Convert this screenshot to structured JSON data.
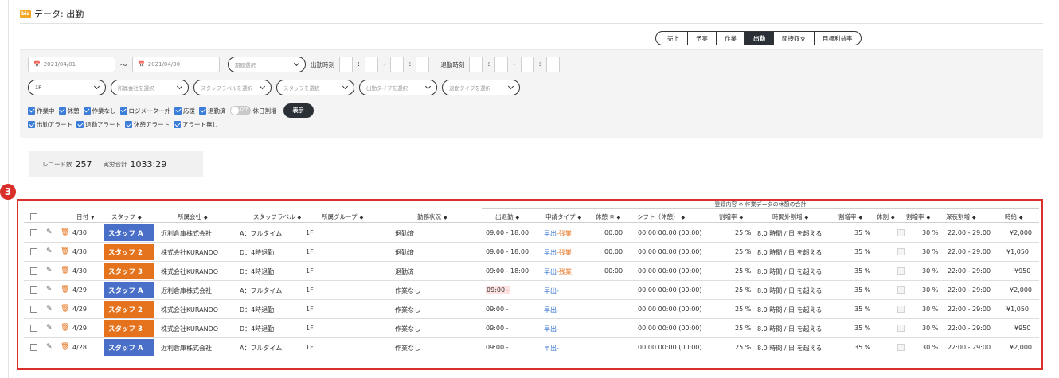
{
  "header": {
    "logo_text": "bis",
    "title": "データ: 出勤"
  },
  "tabs": [
    {
      "label": "売上",
      "active": false
    },
    {
      "label": "予実",
      "active": false
    },
    {
      "label": "作業",
      "active": false
    },
    {
      "label": "出勤",
      "active": true
    },
    {
      "label": "間接収支",
      "active": false
    },
    {
      "label": "目標利益率",
      "active": false
    }
  ],
  "filters": {
    "date_from": "2021/04/01",
    "range_sep": "〜",
    "date_to": "2021/04/30",
    "period_placeholder": "期間選択",
    "clock_in_label": "出勤時刻",
    "clock_out_label": "退勤時刻",
    "colon": ":",
    "dash": "-",
    "floor_value": "1F",
    "company_placeholder": "所属会社を選択",
    "staff_label_placeholder": "スタッフラベルを選択",
    "staff_placeholder": "スタッフを選択",
    "attendance_type_placeholder": "出勤タイプを選択",
    "leave_type_placeholder": "退勤タイプを選択",
    "checks_row1": [
      "作業中",
      "休憩",
      "作業なし",
      "ロジメーター外",
      "応援",
      "退勤済"
    ],
    "toggle_text": "OFF",
    "holiday_label": "休日割増",
    "show_button": "表示",
    "checks_row2": [
      "出勤アラート",
      "退勤アラート",
      "休憩アラート",
      "アラート無し"
    ]
  },
  "summary": {
    "records_label": "レコード数",
    "records_value": "257",
    "actual_label": "実労合計",
    "actual_value": "1033:29"
  },
  "step_badge": "3",
  "table": {
    "group_header": "登録内容 ※ 作業データの休憩の合計",
    "columns": {
      "date": "日付",
      "staff": "スタッフ",
      "company": "所属会社",
      "label": "スタッフラベル",
      "group": "所属グループ",
      "status": "勤務状況",
      "inout": "出退勤",
      "apply": "申請タイプ",
      "break": "休憩 ※",
      "shift": "シフト（休憩）",
      "rate1": "割増率",
      "overtime": "時間外割増",
      "rate2": "割増率",
      "holiday": "休割",
      "rate3": "割増率",
      "night": "深夜割増",
      "wage": "時給"
    },
    "rows": [
      {
        "date": "4/30",
        "staff": "スタッフ A",
        "staff_color": "#4a6fc8",
        "company": "近利倉庫株式会社",
        "label": "A：フルタイム",
        "group": "1F",
        "status": "退勤済",
        "inout": "09:00 - 18:00",
        "apply_a": "早出",
        "apply_b": "-残業",
        "brk": "00:00",
        "shift": "00:00 00:00 (00:00)",
        "rate1": "25 %",
        "overtime": "8.0 時間 / 日 を超える",
        "rate2": "35 %",
        "rate3": "30 %",
        "night": "22:00 - 29:00",
        "wage": "¥2,000"
      },
      {
        "date": "4/30",
        "staff": "スタッフ 2",
        "staff_color": "#e5731e",
        "company": "株式会社KURANDO",
        "label": "D：4時退勤",
        "group": "1F",
        "status": "退勤済",
        "inout": "09:00 - 18:00",
        "apply_a": "早出",
        "apply_b": "-残業",
        "brk": "00:00",
        "shift": "00:00 00:00 (00:00)",
        "rate1": "25 %",
        "overtime": "8.0 時間 / 日 を超える",
        "rate2": "35 %",
        "rate3": "30 %",
        "night": "22:00 - 29:00",
        "wage": "¥1,050"
      },
      {
        "date": "4/30",
        "staff": "スタッフ 3",
        "staff_color": "#e5731e",
        "company": "株式会社KURANDO",
        "label": "D：4時退勤",
        "group": "1F",
        "status": "退勤済",
        "inout": "09:00 - 18:00",
        "apply_a": "早出",
        "apply_b": "-残業",
        "brk": "00:00",
        "shift": "00:00 00:00 (00:00)",
        "rate1": "25 %",
        "overtime": "8.0 時間 / 日 を超える",
        "rate2": "35 %",
        "rate3": "30 %",
        "night": "22:00 - 29:00",
        "wage": "¥950"
      },
      {
        "date": "4/29",
        "staff": "スタッフ A",
        "staff_color": "#4a6fc8",
        "company": "近利倉庫株式会社",
        "label": "A：フルタイム",
        "group": "1F",
        "status": "作業なし",
        "inout": "09:00 -",
        "apply_a": "早出",
        "apply_b": "-",
        "brk": "",
        "shift": "00:00 00:00 (00:00)",
        "rate1": "25 %",
        "overtime": "8.0 時間 / 日 を超える",
        "rate2": "35 %",
        "rate3": "30 %",
        "night": "22:00 - 29:00",
        "wage": "¥2,000"
      },
      {
        "date": "4/29",
        "staff": "スタッフ 2",
        "staff_color": "#e5731e",
        "company": "株式会社KURANDO",
        "label": "D：4時退勤",
        "group": "1F",
        "status": "作業なし",
        "inout": "09:00 -",
        "apply_a": "早出",
        "apply_b": "-",
        "brk": "",
        "shift": "00:00 00:00 (00:00)",
        "rate1": "25 %",
        "overtime": "8.0 時間 / 日 を超える",
        "rate2": "35 %",
        "rate3": "30 %",
        "night": "22:00 - 29:00",
        "wage": "¥1,050"
      },
      {
        "date": "4/29",
        "staff": "スタッフ 3",
        "staff_color": "#e5731e",
        "company": "株式会社KURANDO",
        "label": "D：4時退勤",
        "group": "1F",
        "status": "作業なし",
        "inout": "09:00 -",
        "apply_a": "早出",
        "apply_b": "-",
        "brk": "",
        "shift": "00:00 00:00 (00:00)",
        "rate1": "25 %",
        "overtime": "8.0 時間 / 日 を超える",
        "rate2": "35 %",
        "rate3": "30 %",
        "night": "22:00 - 29:00",
        "wage": "¥950"
      },
      {
        "date": "4/28",
        "staff": "スタッフ A",
        "staff_color": "#4a6fc8",
        "company": "近利倉庫株式会社",
        "label": "A：フルタイム",
        "group": "1F",
        "status": "作業なし",
        "inout": "09:00 -",
        "apply_a": "早出",
        "apply_b": "-",
        "brk": "",
        "shift": "00:00 00:00 (00:00)",
        "rate1": "25 %",
        "overtime": "8.0 時間 / 日 を超える",
        "rate2": "35 %",
        "rate3": "30 %",
        "night": "22:00 - 29:00",
        "wage": "¥2,000"
      }
    ]
  },
  "icons": {
    "sort": "sort-icon",
    "sort_down": "sort-down-icon",
    "calendar": "calendar-icon",
    "edit": "pencil-icon",
    "delete": "trash-icon",
    "chevron": "chevron-down-icon"
  },
  "colors": {
    "accent_red": "#d9302c",
    "staff_blue": "#4a6fc8",
    "staff_orange": "#e5731e",
    "checkbox_blue": "#3c7dd9",
    "dark_button": "#2b2f36"
  }
}
